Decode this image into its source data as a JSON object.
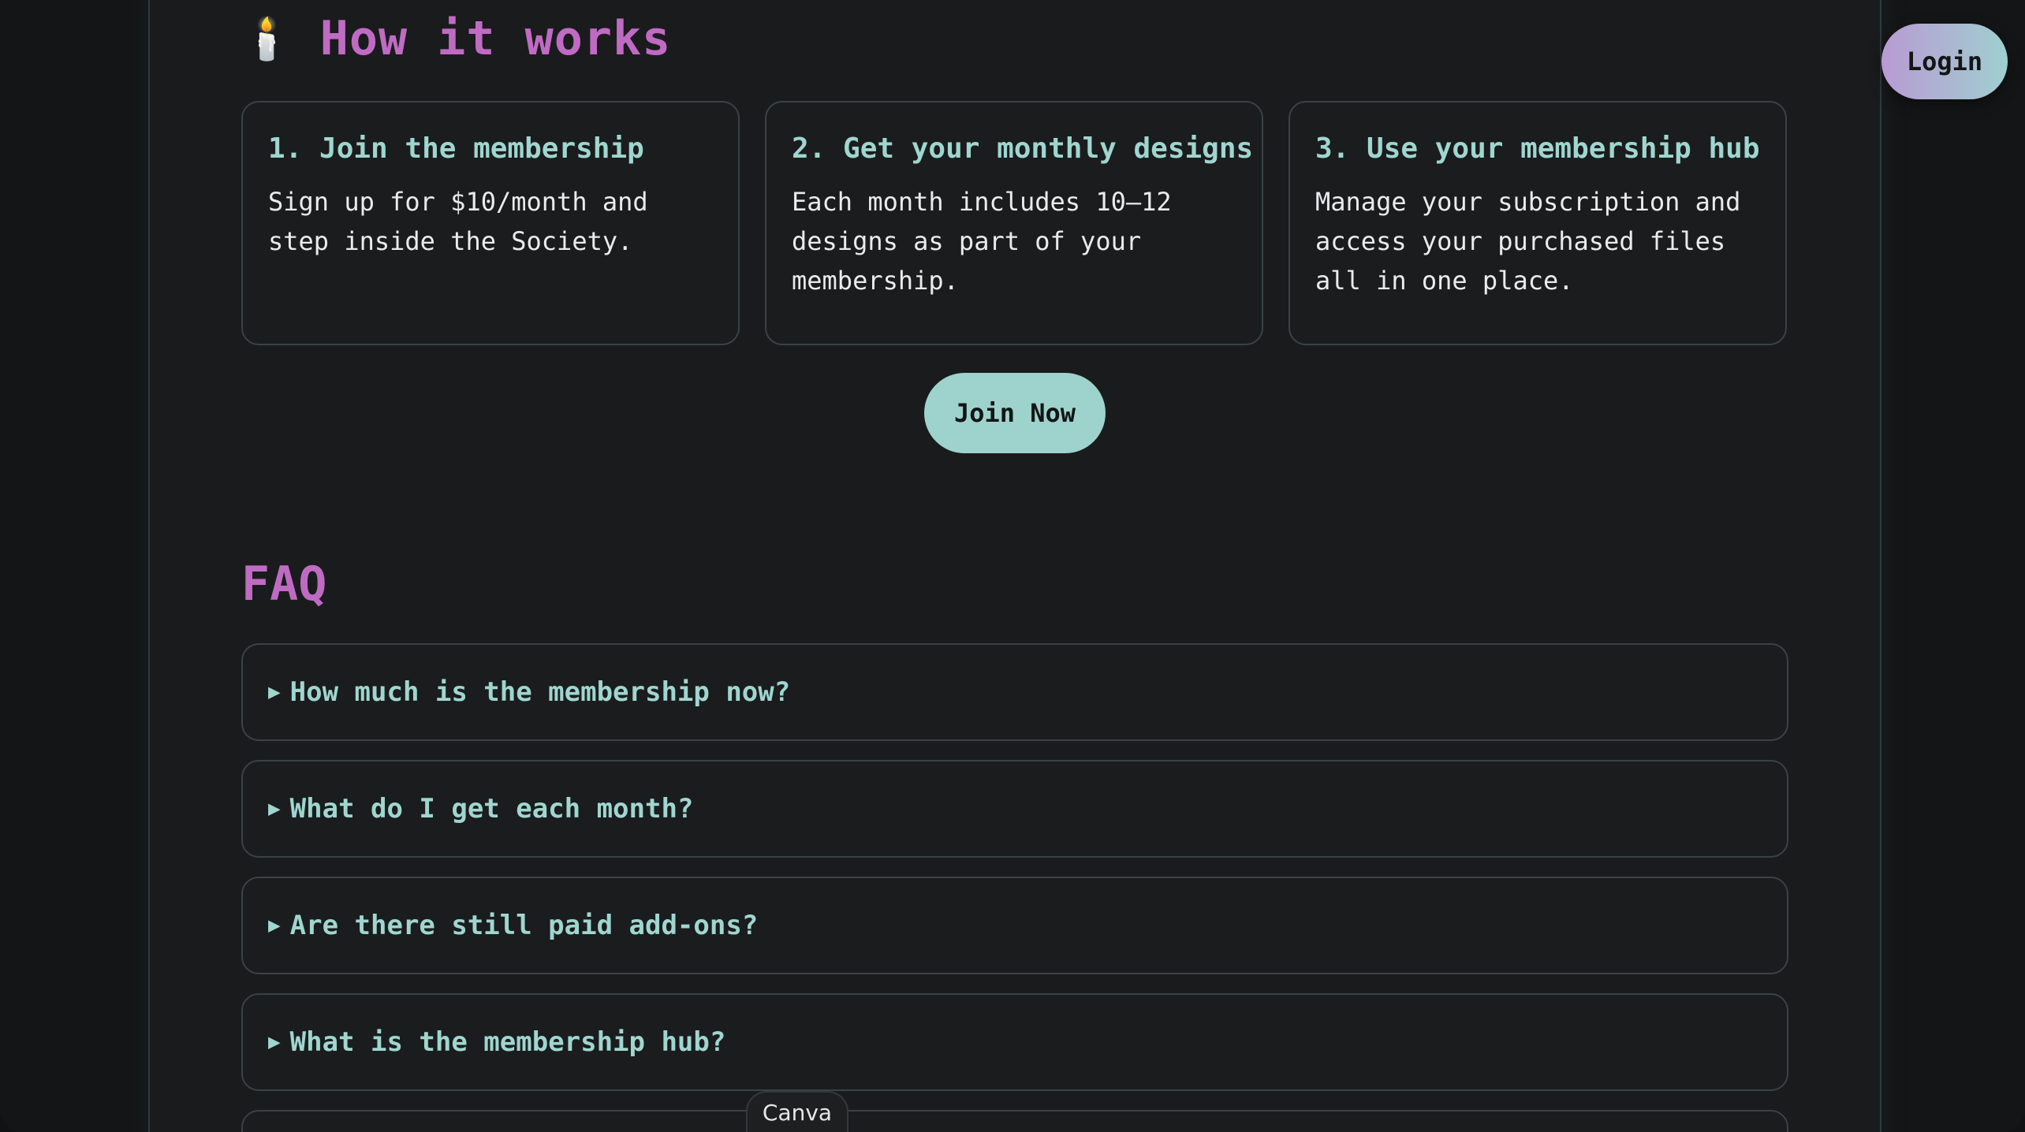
{
  "how_it_works": {
    "icon": "candle-icon",
    "title": "How it works",
    "cards": [
      {
        "heading": "1. Join the membership",
        "body": "Sign up for $10/month and step inside the Society."
      },
      {
        "heading": "2. Get your monthly designs",
        "body": "Each month includes 10–12 designs as part of your membership."
      },
      {
        "heading": "3. Use your membership hub",
        "body": "Manage your subscription and access your purchased files all in one place."
      }
    ],
    "cta_label": "Join Now"
  },
  "faq": {
    "title": "FAQ",
    "items": [
      {
        "question": "How much is the membership now?"
      },
      {
        "question": "What do I get each month?"
      },
      {
        "question": "Are there still paid add-ons?"
      },
      {
        "question": "What is the membership hub?"
      }
    ]
  },
  "header": {
    "login_label": "Login"
  },
  "footer": {
    "canva_label": "Canva"
  },
  "colors": {
    "accent_pink": "#c06bc3",
    "accent_teal": "#9fd6cf",
    "background": "#1a1b1d"
  }
}
